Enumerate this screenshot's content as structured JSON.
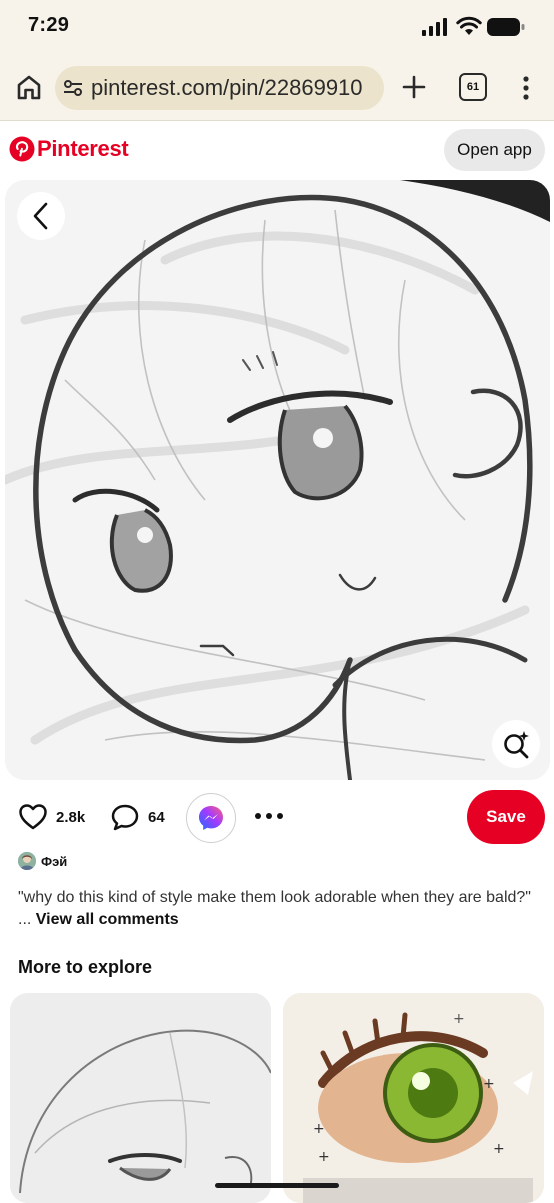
{
  "status_bar": {
    "time": "7:29"
  },
  "browser": {
    "url": "pinterest.com/pin/22869910",
    "tab_count": "61"
  },
  "header": {
    "brand": "Pinterest",
    "open_app_label": "Open app"
  },
  "pin": {
    "likes": "2.8k",
    "comments": "64",
    "save_label": "Save",
    "author": "Фэй",
    "description": "\"why do this kind of style make them look adorable when they are bald?\" ...",
    "view_comments_label": "View all comments"
  },
  "explore": {
    "title": "More to explore"
  },
  "colors": {
    "brand_red": "#e60023",
    "browser_bg": "#f7f3ea",
    "url_bar_bg": "#ece3cc"
  }
}
